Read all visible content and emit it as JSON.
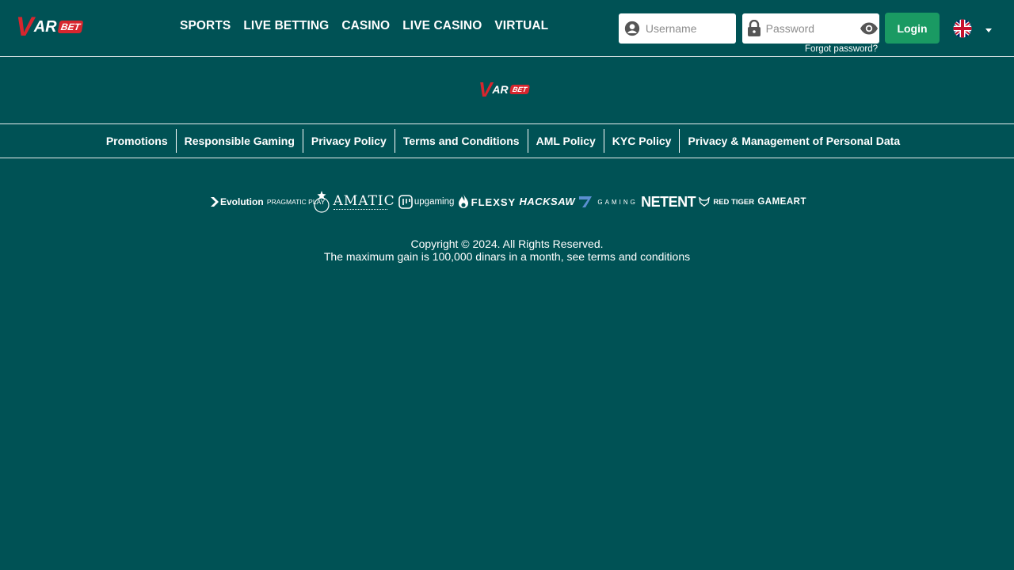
{
  "header": {
    "logo": {
      "v": "V",
      "ar": "AR",
      "bet": "BET"
    },
    "nav": [
      "SPORTS",
      "LIVE BETTING",
      "CASINO",
      "LIVE CASINO",
      "VIRTUAL"
    ],
    "login": {
      "username_placeholder": "Username",
      "password_placeholder": "Password",
      "forgot": "Forgot password?",
      "button": "Login"
    },
    "language": {
      "flag": "uk-flag-icon"
    }
  },
  "footer": {
    "logo": {
      "v": "V",
      "ar": "AR",
      "bet": "BET"
    },
    "links": [
      "Promotions",
      "Responsible Gaming",
      "Privacy Policy",
      "Terms and Conditions",
      "AML Policy",
      "KYC Policy",
      "Privacy & Management of Personal Data"
    ],
    "providers": [
      {
        "name": "Evolution",
        "text": "Evolution"
      },
      {
        "name": "Pragmatic Play",
        "text": "PRAGMATIC PLAY"
      },
      {
        "name": "Amatic",
        "text": "AMATIC"
      },
      {
        "name": "Upgaming",
        "text": "upgaming"
      },
      {
        "name": "Flexsy",
        "text": "FLEXSY"
      },
      {
        "name": "Hacksaw",
        "text": "HACKSAW"
      },
      {
        "name": "7 Gaming",
        "text": "GAMING"
      },
      {
        "name": "NetEnt",
        "text": "NETENT"
      },
      {
        "name": "Red Tiger",
        "text": "RED TIGER"
      },
      {
        "name": "GameArt",
        "text": "GAMEART"
      }
    ],
    "copyright": "Copyright © 2024. All Rights Reserved.",
    "max_gain": "The maximum gain is 100,000 dinars in a month, see terms and conditions"
  },
  "colors": {
    "background": "#005255",
    "accent_green": "#1a9a63",
    "brand_red": "#d7262e"
  }
}
